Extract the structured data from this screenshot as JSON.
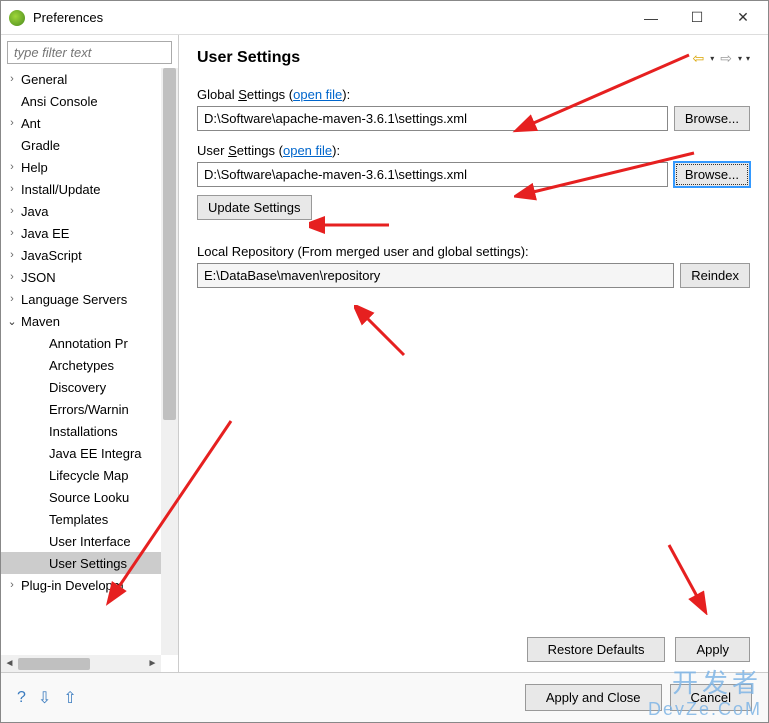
{
  "window": {
    "title": "Preferences"
  },
  "filter": {
    "placeholder": "type filter text"
  },
  "tree": {
    "items": [
      {
        "label": "General",
        "expandable": true,
        "level": 0
      },
      {
        "label": "Ansi Console",
        "expandable": false,
        "level": 0
      },
      {
        "label": "Ant",
        "expandable": true,
        "level": 0
      },
      {
        "label": "Gradle",
        "expandable": false,
        "level": 0
      },
      {
        "label": "Help",
        "expandable": true,
        "level": 0
      },
      {
        "label": "Install/Update",
        "expandable": true,
        "level": 0
      },
      {
        "label": "Java",
        "expandable": true,
        "level": 0
      },
      {
        "label": "Java EE",
        "expandable": true,
        "level": 0
      },
      {
        "label": "JavaScript",
        "expandable": true,
        "level": 0
      },
      {
        "label": "JSON",
        "expandable": true,
        "level": 0
      },
      {
        "label": "Language Servers",
        "expandable": true,
        "level": 0
      },
      {
        "label": "Maven",
        "expandable": true,
        "expanded": true,
        "level": 0
      },
      {
        "label": "Annotation Pr",
        "expandable": false,
        "level": 1
      },
      {
        "label": "Archetypes",
        "expandable": false,
        "level": 1
      },
      {
        "label": "Discovery",
        "expandable": false,
        "level": 1
      },
      {
        "label": "Errors/Warnin",
        "expandable": false,
        "level": 1
      },
      {
        "label": "Installations",
        "expandable": false,
        "level": 1
      },
      {
        "label": "Java EE Integra",
        "expandable": false,
        "level": 1
      },
      {
        "label": "Lifecycle Map",
        "expandable": false,
        "level": 1
      },
      {
        "label": "Source Looku",
        "expandable": false,
        "level": 1
      },
      {
        "label": "Templates",
        "expandable": false,
        "level": 1
      },
      {
        "label": "User Interface",
        "expandable": false,
        "level": 1
      },
      {
        "label": "User Settings",
        "expandable": false,
        "level": 1,
        "selected": true
      },
      {
        "label": "Plug-in Developm",
        "expandable": true,
        "level": 0
      }
    ]
  },
  "page": {
    "heading": "User Settings",
    "global_label_prefix": "Global ",
    "global_label_key": "S",
    "global_label_suffix": "ettings (",
    "open_file": "open file",
    "label_close": "):",
    "global_value": "D:\\Software\\apache-maven-3.6.1\\settings.xml",
    "browse": "Browse...",
    "user_label_prefix": "User ",
    "user_label_key": "S",
    "user_label_suffix": "ettings (",
    "user_value": "D:\\Software\\apache-maven-3.6.1\\settings.xml",
    "update_settings": "Update Settings",
    "repo_label": "Local Repository (From merged user and global settings):",
    "repo_value": "E:\\DataBase\\maven\\repository",
    "reindex": "Reindex",
    "restore_defaults": "Restore Defaults",
    "apply": "Apply"
  },
  "footer": {
    "apply_close": "Apply and Close",
    "cancel": "Cancel"
  },
  "watermark": {
    "line1": "开发者",
    "line2": "DevZe.CoM"
  }
}
